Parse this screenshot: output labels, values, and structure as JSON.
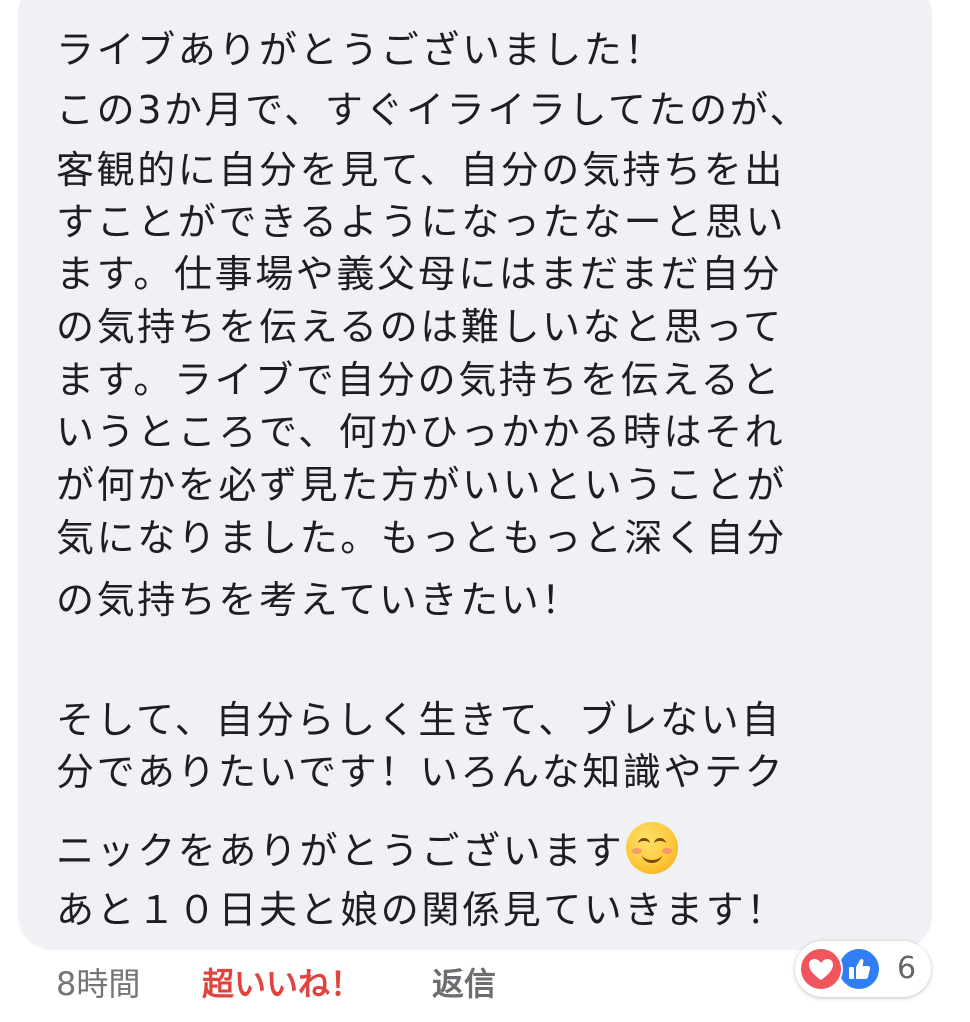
{
  "comment": {
    "lines": [
      "ライブありがとうございました！",
      "この3か月で、すぐイライラしてたのが、",
      "客観的に自分を見て、自分の気持ちを出",
      "すことができるようになったなーと思い",
      "ます。仕事場や義父母にはまだまだ自分",
      "の気持ちを伝えるのは難しいなと思って",
      "ます。ライブで自分の気持ちを伝えると",
      "いうところで、何かひっかかる時はそれ",
      "が何かを必ず見た方がいいということが",
      "気になりました。もっともっと深く自分",
      "の気持ちを考えていきたい！",
      "そして、自分らしく生きて、ブレない自",
      "分でありたいです！いろんな知識やテク",
      "ニックをありがとうございます",
      "あと１０日夫と娘の関係見ていきます！"
    ]
  },
  "emoji": "smiling-face-icon",
  "footer": {
    "timestamp": "8時間",
    "reaction_label": "超いいね！",
    "reply_label": "返信"
  },
  "reactions": {
    "icons": [
      "heart-icon",
      "thumbs-up-icon"
    ],
    "count": "6"
  },
  "colors": {
    "bubble_bg": "#f0f1f4",
    "text": "#1c1e21",
    "love_red": "#e2433f",
    "like_blue": "#2f7ef3",
    "heart_bg": "#f2545e"
  }
}
